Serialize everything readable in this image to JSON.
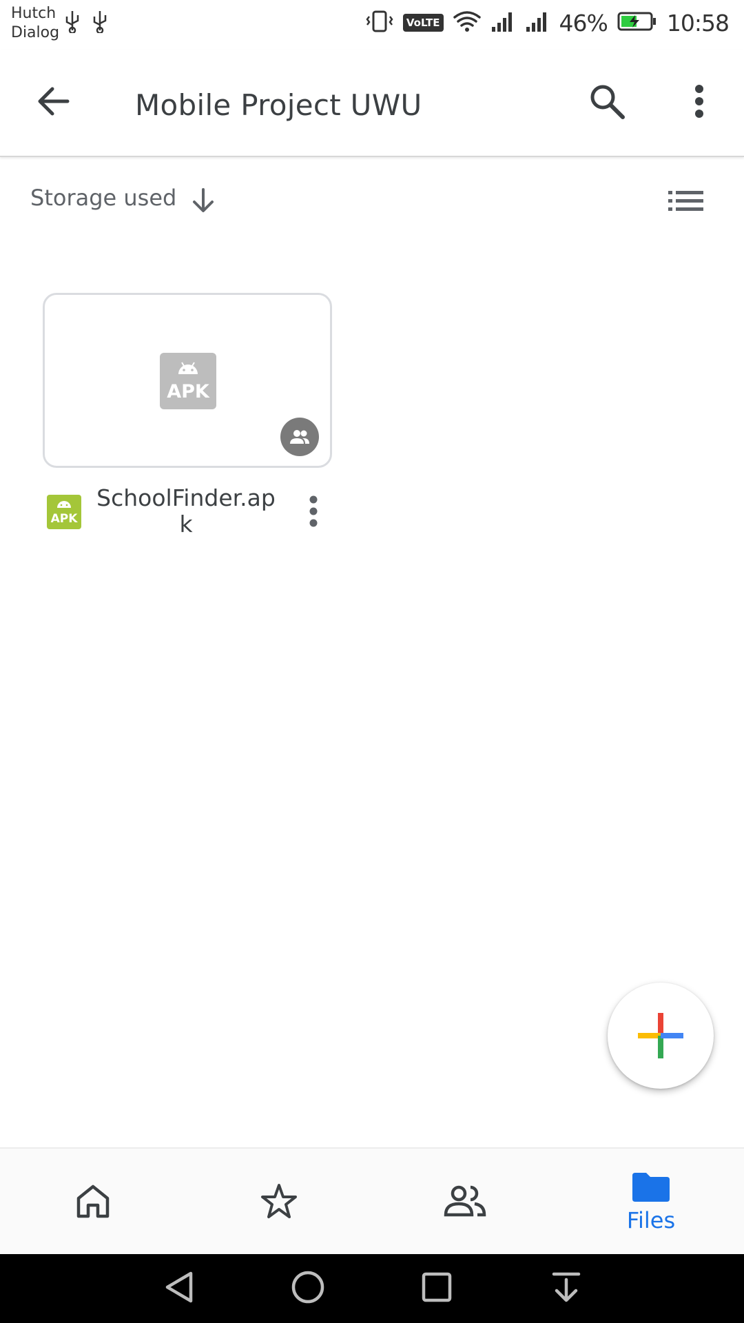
{
  "status_bar": {
    "carrier_line1": "Hutch",
    "carrier_line2": "Dialog",
    "volte": "VoLTE",
    "battery": "46%",
    "time": "10:58"
  },
  "appbar": {
    "title": "Mobile Project UWU",
    "back_icon": "arrow-back-icon",
    "search_icon": "search-icon",
    "more_icon": "more-vert-icon"
  },
  "sort": {
    "label": "Storage used",
    "direction_icon": "arrow-down-icon",
    "view_toggle_icon": "list-view-icon"
  },
  "files": [
    {
      "name": "SchoolFinder.apk",
      "thumb_label": "APK",
      "type_icon_label": "APK",
      "shared": true
    }
  ],
  "fab": {
    "icon": "plus-icon"
  },
  "bottom_nav": {
    "items": [
      {
        "icon": "home-icon",
        "label": ""
      },
      {
        "icon": "star-icon",
        "label": ""
      },
      {
        "icon": "shared-people-icon",
        "label": ""
      },
      {
        "icon": "folder-icon",
        "label": "Files",
        "active": true
      }
    ]
  },
  "colors": {
    "accent": "#1a73e8",
    "apk_green": "#a4c639",
    "fab_red": "#ea4335",
    "fab_blue": "#4285f4",
    "fab_yellow": "#fbbc04",
    "fab_green": "#34a853"
  }
}
